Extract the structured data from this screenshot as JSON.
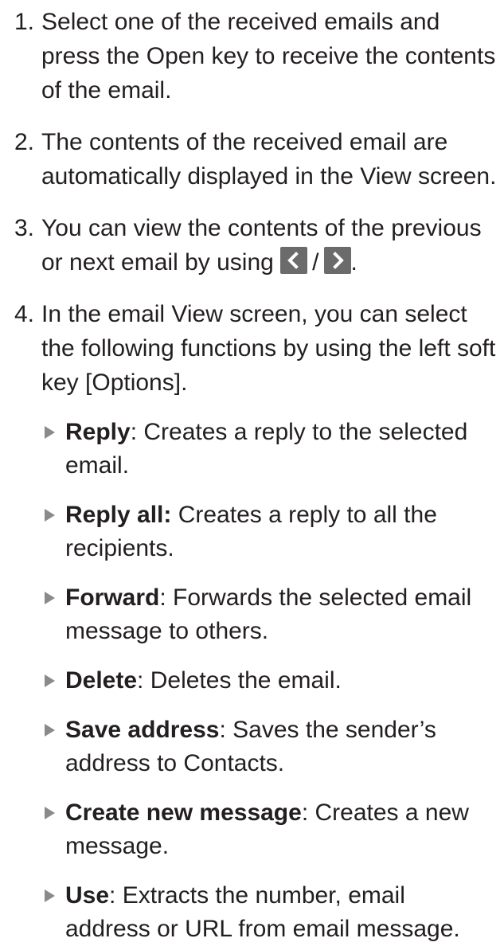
{
  "steps": [
    {
      "num": "1.",
      "text": "Select one of the received emails and press the Open key to receive the contents of the email."
    },
    {
      "num": "2.",
      "text": "The contents of the received email are automatically displayed in the View screen."
    },
    {
      "num": "3.",
      "text_before": "You can view the contents of the previous or next email by using ",
      "separator": "/",
      "text_after": ".",
      "icons": [
        "chevron-left-icon",
        "chevron-right-icon"
      ]
    },
    {
      "num": "4.",
      "text": "In the email View screen, you can select the following functions by using the left soft key [Options]."
    }
  ],
  "options": [
    {
      "term": "Reply",
      "sep": ":",
      "desc": " Creates a reply to the selected email."
    },
    {
      "term": "Reply all:",
      "sep": "",
      "desc": " Creates a reply to all the recipients."
    },
    {
      "term": "Forward",
      "sep": ":",
      "desc": " Forwards the selected email message to others."
    },
    {
      "term": "Delete",
      "sep": ":",
      "desc": " Deletes the email."
    },
    {
      "term": "Save address",
      "sep": ":",
      "desc": " Saves the sender’s address to Contacts."
    },
    {
      "term": "Create new message",
      "sep": ":",
      "desc": " Creates a new message."
    },
    {
      "term": "Use",
      "sep": ":",
      "desc": " Extracts the number, email address or URL from email message."
    }
  ],
  "colors": {
    "text": "#231f20",
    "icon_bg": "#6b6b6b",
    "bullet": "#8a8a8a"
  }
}
